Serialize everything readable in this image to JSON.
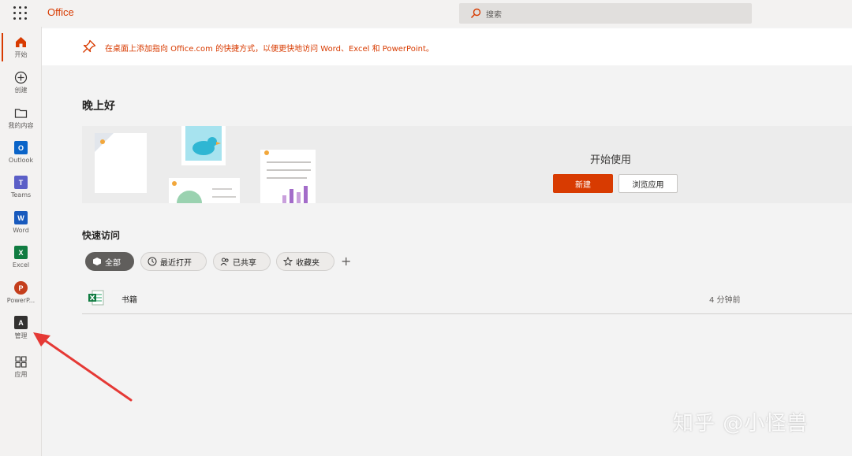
{
  "header": {
    "brand": "Office",
    "search_placeholder": "搜索"
  },
  "rail": {
    "items": [
      {
        "label": "开始",
        "icon": "home-icon"
      },
      {
        "label": "创建",
        "icon": "plus-circle-icon"
      },
      {
        "label": "我的内容",
        "icon": "folder-icon"
      },
      {
        "label": "Outlook",
        "icon": "outlook-icon"
      },
      {
        "label": "Teams",
        "icon": "teams-icon"
      },
      {
        "label": "Word",
        "icon": "word-icon"
      },
      {
        "label": "Excel",
        "icon": "excel-icon"
      },
      {
        "label": "PowerP...",
        "icon": "powerpoint-icon"
      },
      {
        "label": "管理",
        "icon": "admin-icon"
      },
      {
        "label": "应用",
        "icon": "apps-icon"
      }
    ]
  },
  "banner": {
    "text": "在桌面上添加指向 Office.com 的快捷方式，以便更快地访问 Word、Excel 和 PowerPoint。"
  },
  "main": {
    "greeting": "晚上好",
    "hero_title": "开始使用",
    "new_button": "新建",
    "browse_button": "浏览应用",
    "quick_access_title": "快速访问",
    "filters": [
      "全部",
      "最近打开",
      "已共享",
      "收藏夹"
    ],
    "add_filter": "+",
    "files": [
      {
        "name": "书籍",
        "time": "4 分钟前"
      }
    ]
  },
  "watermark": "知乎 @小怪兽",
  "colors": {
    "accent": "#d83b01",
    "arrow": "#e53935"
  }
}
